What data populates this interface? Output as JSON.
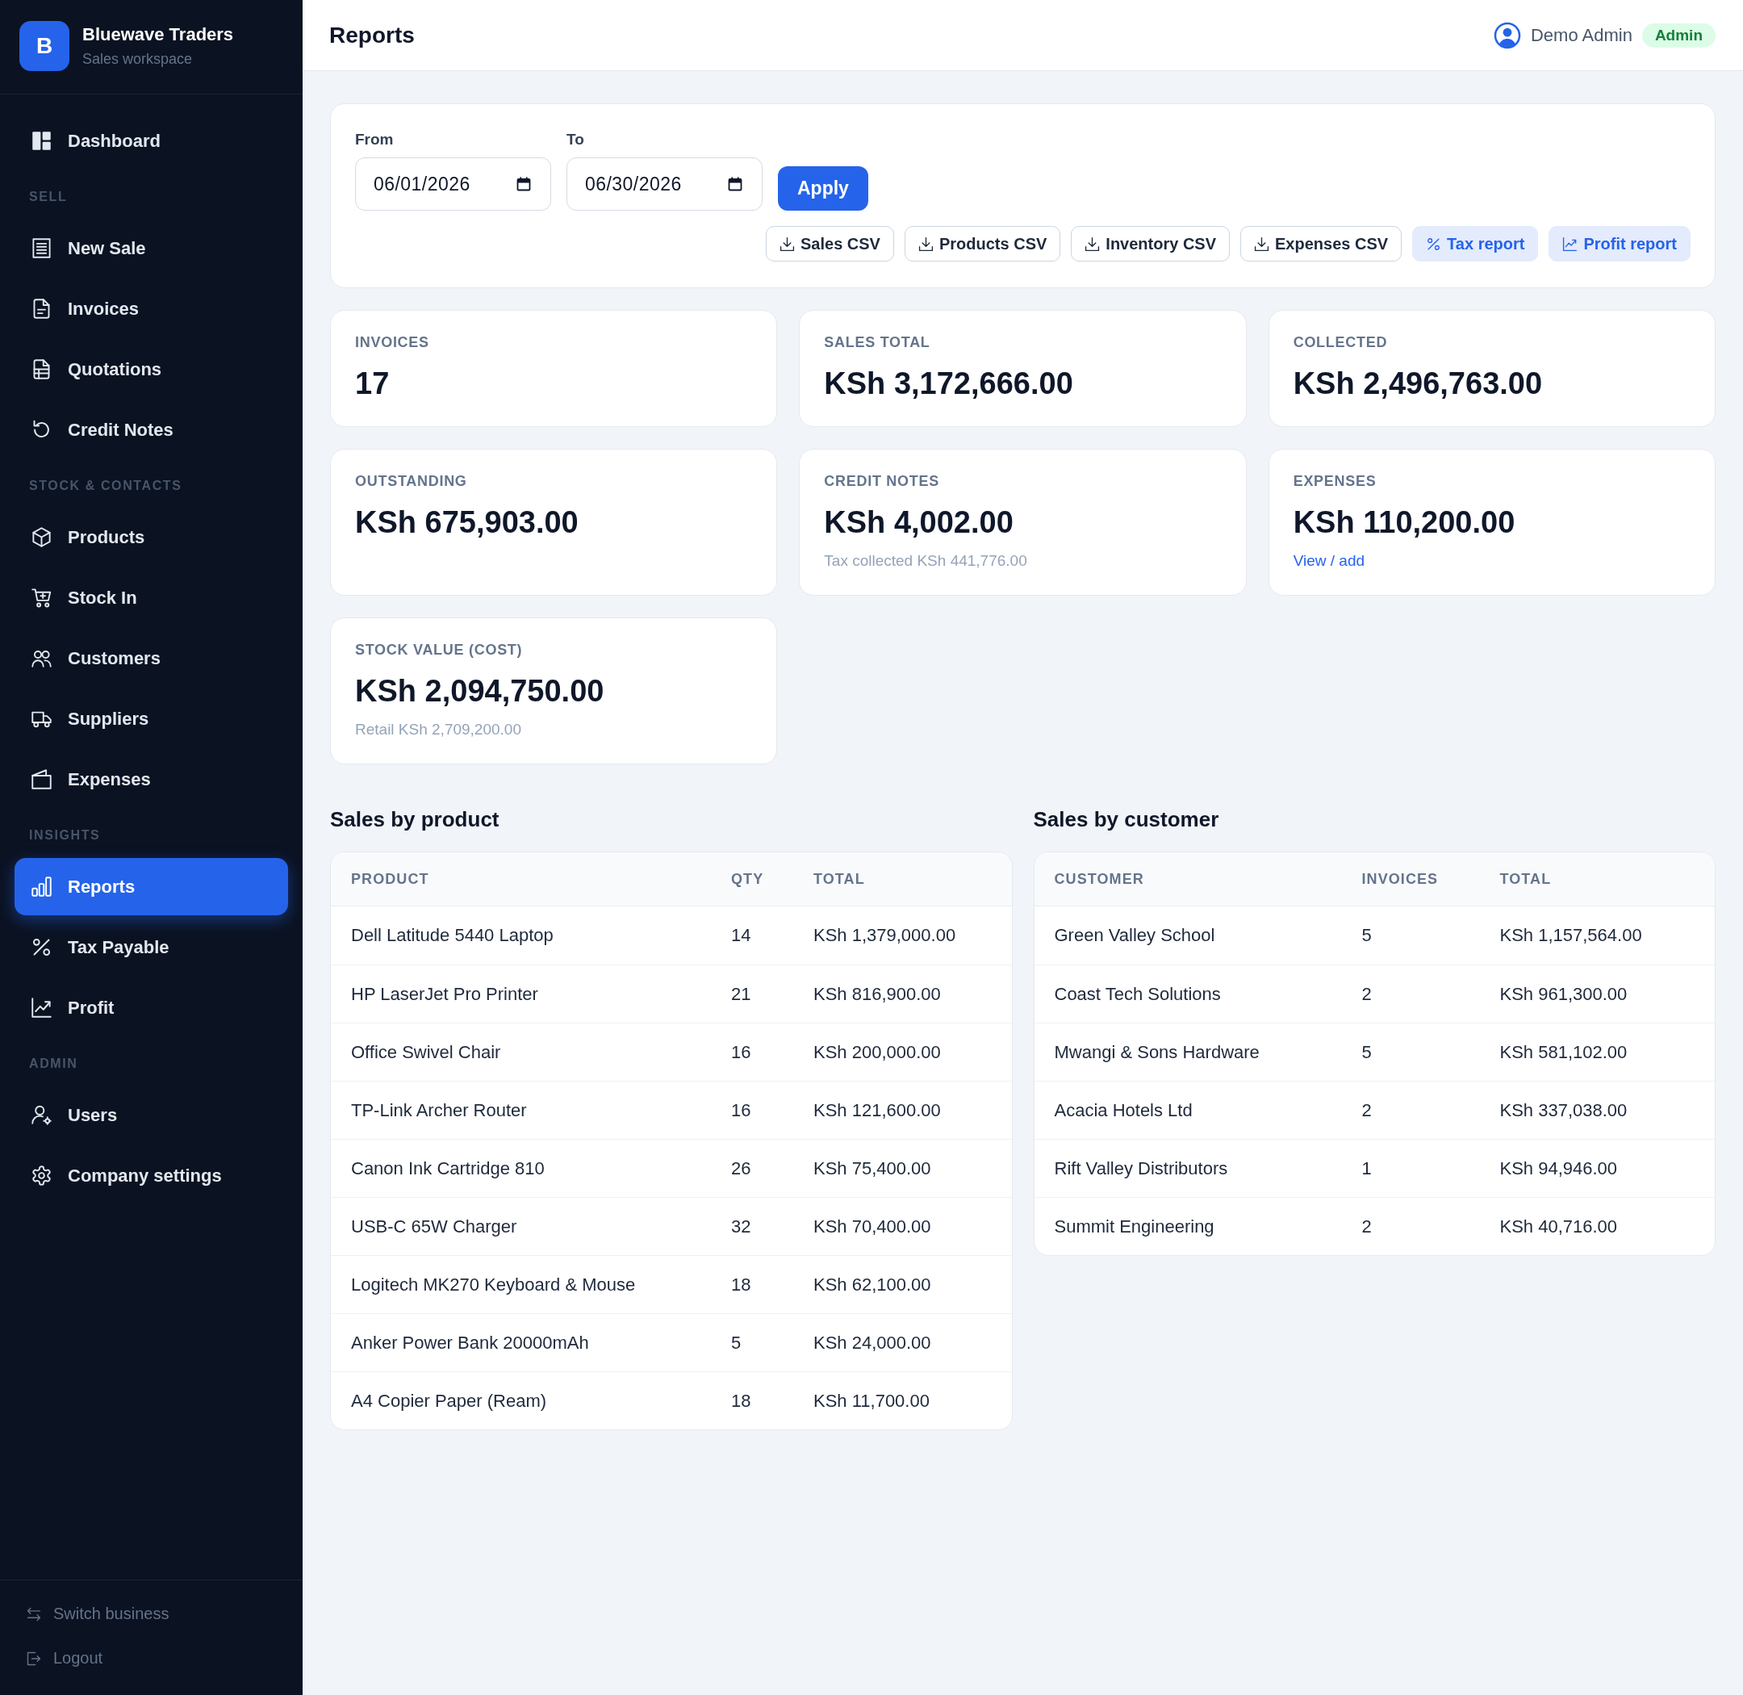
{
  "sidebar": {
    "brand": {
      "logo_letter": "B",
      "name": "Bluewave Traders",
      "subtitle": "Sales workspace"
    },
    "sections": [
      {
        "items": [
          {
            "label": "Dashboard",
            "selected": false
          }
        ]
      },
      {
        "title": "SELL",
        "items": [
          {
            "label": "New Sale",
            "selected": false
          },
          {
            "label": "Invoices",
            "selected": false
          },
          {
            "label": "Quotations",
            "selected": false
          },
          {
            "label": "Credit Notes",
            "selected": false
          }
        ]
      },
      {
        "title": "STOCK & CONTACTS",
        "items": [
          {
            "label": "Products",
            "selected": false
          },
          {
            "label": "Stock In",
            "selected": false
          },
          {
            "label": "Customers",
            "selected": false
          },
          {
            "label": "Suppliers",
            "selected": false
          },
          {
            "label": "Expenses",
            "selected": false
          }
        ]
      },
      {
        "title": "INSIGHTS",
        "items": [
          {
            "label": "Reports",
            "selected": true
          },
          {
            "label": "Tax Payable",
            "selected": false
          },
          {
            "label": "Profit",
            "selected": false
          }
        ]
      },
      {
        "title": "ADMIN",
        "items": [
          {
            "label": "Users",
            "selected": false
          },
          {
            "label": "Company settings",
            "selected": false
          }
        ]
      }
    ],
    "footer_links": [
      "Switch business",
      "Logout"
    ]
  },
  "header": {
    "title": "Reports",
    "user": "Demo Admin",
    "role": "Admin"
  },
  "filters": {
    "from": {
      "label": "From",
      "value": "06/01/2026"
    },
    "to": {
      "label": "To",
      "value": "06/30/2026"
    },
    "apply": "Apply",
    "exports": [
      {
        "label": "Sales CSV",
        "kind": "csv"
      },
      {
        "label": "Products CSV",
        "kind": "csv"
      },
      {
        "label": "Inventory CSV",
        "kind": "csv"
      },
      {
        "label": "Expenses CSV",
        "kind": "csv"
      },
      {
        "label": "Tax report",
        "kind": "tax"
      },
      {
        "label": "Profit report",
        "kind": "profit"
      }
    ]
  },
  "stats": [
    {
      "label": "INVOICES",
      "value": "17"
    },
    {
      "label": "SALES TOTAL",
      "value": "KSh 3,172,666.00"
    },
    {
      "label": "COLLECTED",
      "value": "KSh 2,496,763.00"
    },
    {
      "label": "OUTSTANDING",
      "value": "KSh 675,903.00"
    },
    {
      "label": "CREDIT NOTES",
      "value": "KSh 4,002.00",
      "note": "Tax collected KSh 441,776.00"
    },
    {
      "label": "EXPENSES",
      "value": "KSh 110,200.00",
      "link": "View / add"
    },
    {
      "label": "STOCK VALUE (COST)",
      "value": "KSh 2,094,750.00",
      "note": "Retail KSh 2,709,200.00"
    }
  ],
  "sales_by_product": {
    "title": "Sales by product",
    "columns": [
      "PRODUCT",
      "QTY",
      "TOTAL"
    ],
    "rows": [
      [
        "Dell Latitude 5440 Laptop",
        "14",
        "KSh 1,379,000.00"
      ],
      [
        "HP LaserJet Pro Printer",
        "21",
        "KSh 816,900.00"
      ],
      [
        "Office Swivel Chair",
        "16",
        "KSh 200,000.00"
      ],
      [
        "TP-Link Archer Router",
        "16",
        "KSh 121,600.00"
      ],
      [
        "Canon Ink Cartridge 810",
        "26",
        "KSh 75,400.00"
      ],
      [
        "USB-C 65W Charger",
        "32",
        "KSh 70,400.00"
      ],
      [
        "Logitech MK270 Keyboard & Mouse",
        "18",
        "KSh 62,100.00"
      ],
      [
        "Anker Power Bank 20000mAh",
        "5",
        "KSh 24,000.00"
      ],
      [
        "A4 Copier Paper (Ream)",
        "18",
        "KSh 11,700.00"
      ]
    ]
  },
  "sales_by_customer": {
    "title": "Sales by customer",
    "columns": [
      "CUSTOMER",
      "INVOICES",
      "TOTAL"
    ],
    "rows": [
      [
        "Green Valley School",
        "5",
        "KSh 1,157,564.00"
      ],
      [
        "Coast Tech Solutions",
        "2",
        "KSh 961,300.00"
      ],
      [
        "Mwangi & Sons Hardware",
        "5",
        "KSh 581,102.00"
      ],
      [
        "Acacia Hotels Ltd",
        "2",
        "KSh 337,038.00"
      ],
      [
        "Rift Valley Distributors",
        "1",
        "KSh 94,946.00"
      ],
      [
        "Summit Engineering",
        "2",
        "KSh 40,716.00"
      ]
    ]
  }
}
